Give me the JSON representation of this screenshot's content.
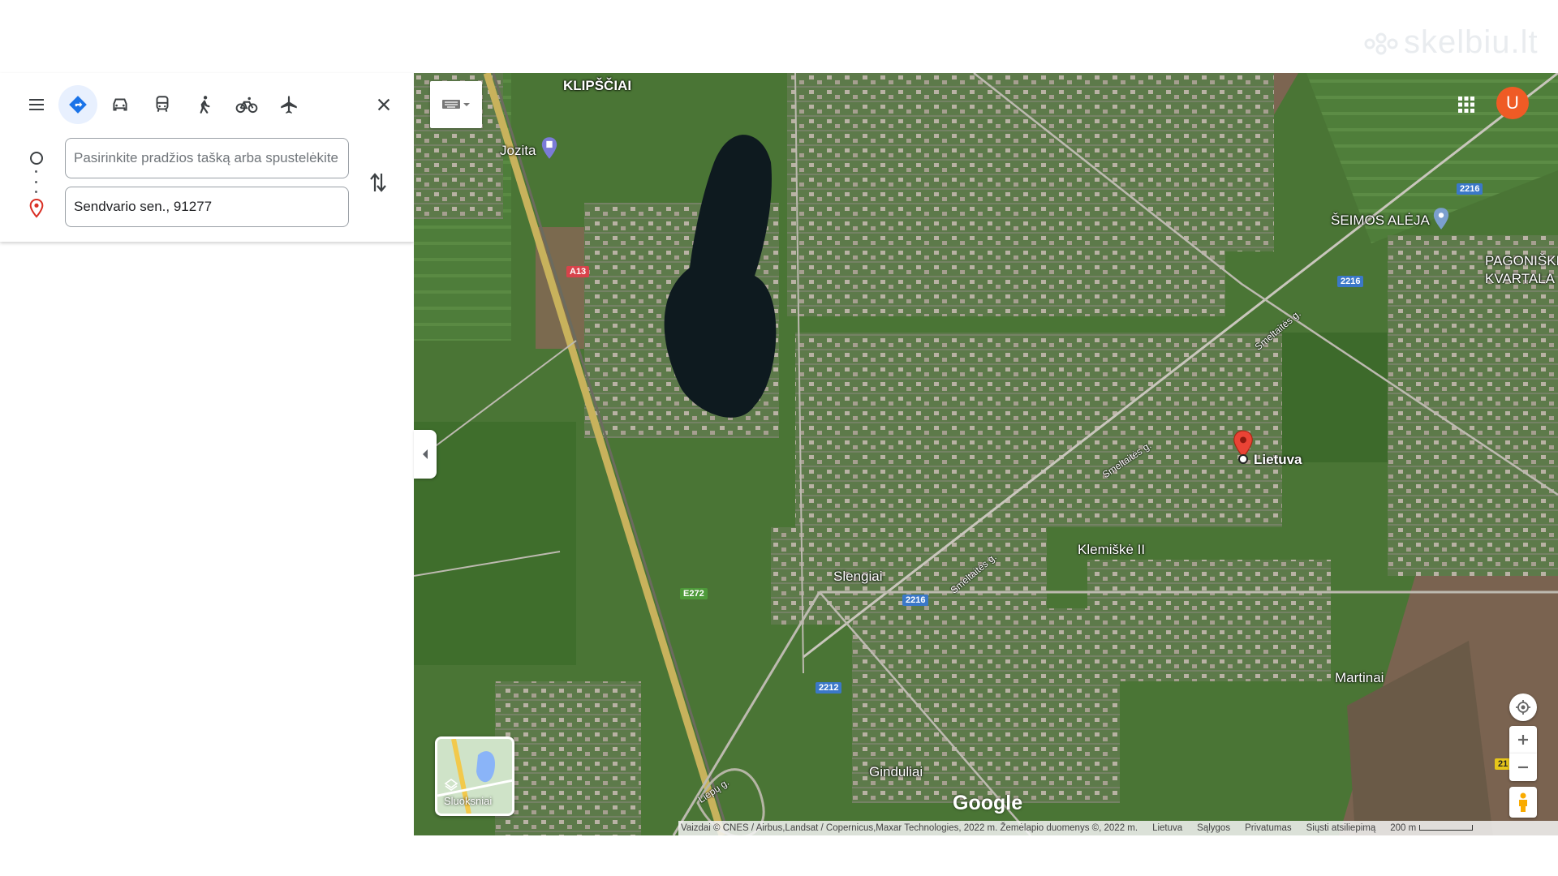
{
  "watermark": "skelbiu.lt",
  "panel": {
    "mode_icons": [
      "menu-icon",
      "directions-icon",
      "car-icon",
      "transit-icon",
      "walk-icon",
      "bike-icon",
      "flight-icon"
    ],
    "origin_placeholder": "Pasirinkite pradžios tašką arba spustelėkite žemėlapį",
    "destination_value": "Sendvario sen., 91277"
  },
  "map": {
    "type": "satellite",
    "labels": {
      "klipsciai": "KLIPŠČIAI",
      "jozita": "Jozita",
      "seimos_aleja": "ŠEIMOS ALĖJA",
      "pagoniskiu_1": "PAGONIŠKI",
      "pagoniskiu_2": "KVARTALA",
      "lietuva": "Lietuva",
      "klemiske": "Klemiškė II",
      "slengiai": "Slengiai",
      "martinai": "Martinai",
      "ginduliai": "Ginduliai"
    },
    "road_names": {
      "smeltaites_1": "Smeltaitės g.",
      "smeltaites_2": "Smeltaitės g.",
      "smeltaites_3": "Smeltaitės g.",
      "liepu": "Liepų g."
    },
    "shields": {
      "a13": "A13",
      "e272": "E272",
      "r2216_a": "2216",
      "r2216_b": "2216",
      "r2216_c": "2216",
      "r2212": "2212",
      "r21": "21"
    },
    "layers_label": "Sluoksniai",
    "google_logo": "Google",
    "account_initial": "U",
    "accent_color": "#ef5b25"
  },
  "attribution": {
    "imagery": "Vaizdai © CNES / Airbus,Landsat / Copernicus,Maxar Technologies, 2022 m. Žemėlapio duomenys ©, 2022 m.",
    "country": "Lietuva",
    "terms": "Sąlygos",
    "privacy": "Privatumas",
    "feedback": "Siųsti atsiliepimą",
    "scale": "200 m"
  }
}
